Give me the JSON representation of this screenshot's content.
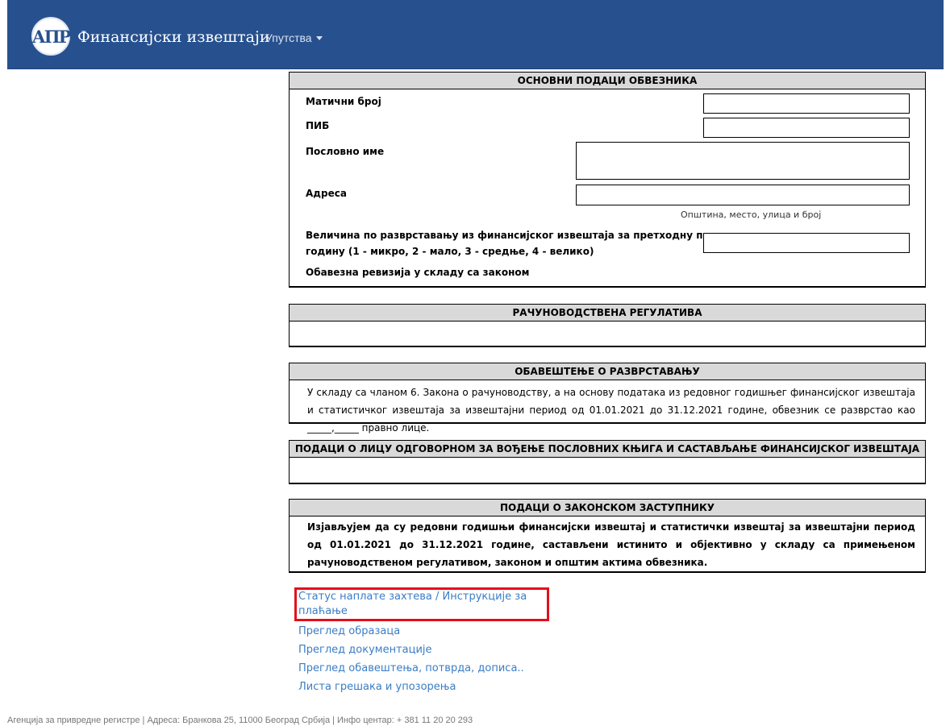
{
  "header": {
    "logo_text": "АПР",
    "brand": "Финансијски извештаји",
    "menu_instructions": "Упутства"
  },
  "basic_data": {
    "title": "ОСНОВНИ ПОДАЦИ ОБВЕЗНИКА",
    "registration_number_label": "Матични број",
    "pib_label": "ПИБ",
    "business_name_label": "Пословно име",
    "address_label": "Адреса",
    "address_caption": "Општина, место, улица и број",
    "size_label_line1": "Величина по разврставању из финансијског извештаја за претходну пословну",
    "size_label_line2": "годину (1 - микро, 2 - мало, 3 - средње, 4 - велико)",
    "audit_label": "Обавезна ревизија у складу са законом"
  },
  "accounting_regulation": {
    "title": "РАЧУНОВОДСТВЕНА РЕГУЛАТИВА"
  },
  "classification_notice": {
    "title": "ОБАВЕШТЕЊЕ О РАЗВРСТАВАЊУ",
    "text": "У складу са чланом 6. Закона о рачуноводству, а на основу података из редовног годишњег финансијског извештаја и статистичког извештаја за извештајни период од 01.01.2021 до 31.12.2021 године, обвезник се разврстао као _____,_____ правно лице."
  },
  "bookkeeper": {
    "title": "ПОДАЦИ О ЛИЦУ ОДГОВОРНОМ ЗА ВОЂЕЊЕ ПОСЛОВНИХ КЊИГА И САСТАВЉАЊЕ ФИНАНСИЈСКОГ ИЗВЕШТАЈА"
  },
  "legal_representative": {
    "title": "ПОДАЦИ О ЗАКОНСКОМ ЗАСТУПНИКУ",
    "text": "Изјављујем да су редовни годишњи финансијски извештај и статистички извештај за извештајни период од 01.01.2021 до 31.12.2021 године, састављени истинито и објективно у складу са примењеном рачуноводственом регулативом, законом и општим актима обвезника."
  },
  "links": [
    "Статус наплате захтева / Инструкције за плаћање",
    "Преглед образаца",
    "Преглед документације",
    "Преглед обавештења, потврда, дописа..",
    "Листа грешака и упозорења"
  ],
  "footer": "Агенција за привредне регистре | Адреса: Бранкова 25, 11000 Београд Србија | Инфо центар: + 381 11 20 20 293"
}
